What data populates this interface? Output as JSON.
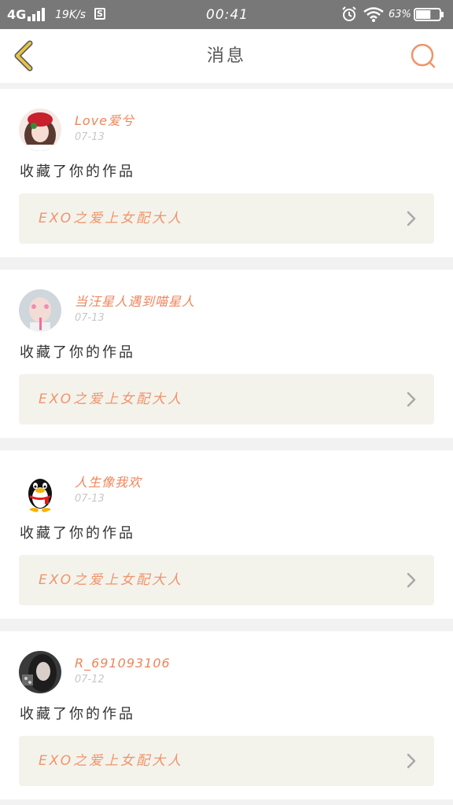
{
  "status_bar": {
    "network": "4G",
    "speed": "19K/s",
    "s_icon_label": "S",
    "time": "00:41",
    "battery_percent": "63%",
    "battery_level": 0.63
  },
  "header": {
    "title": "消息",
    "back_icon": "chevron-left-icon",
    "search_icon": "search-icon"
  },
  "colors": {
    "accent": "#f0845a",
    "back_icon": "#e8c34a",
    "card_box": "#f3f3ec"
  },
  "messages": [
    {
      "username": "Love爱兮",
      "date": "07-13",
      "action": "收藏了你的作品",
      "work_title": "EXO之爱上女配大人"
    },
    {
      "username": "当汪星人遇到喵星人",
      "date": "07-13",
      "action": "收藏了你的作品",
      "work_title": "EXO之爱上女配大人"
    },
    {
      "username": "人生像我欢",
      "date": "07-13",
      "action": "收藏了你的作品",
      "work_title": "EXO之爱上女配大人"
    },
    {
      "username": "R_691093106",
      "date": "07-12",
      "action": "收藏了你的作品",
      "work_title": "EXO之爱上女配大人"
    }
  ]
}
